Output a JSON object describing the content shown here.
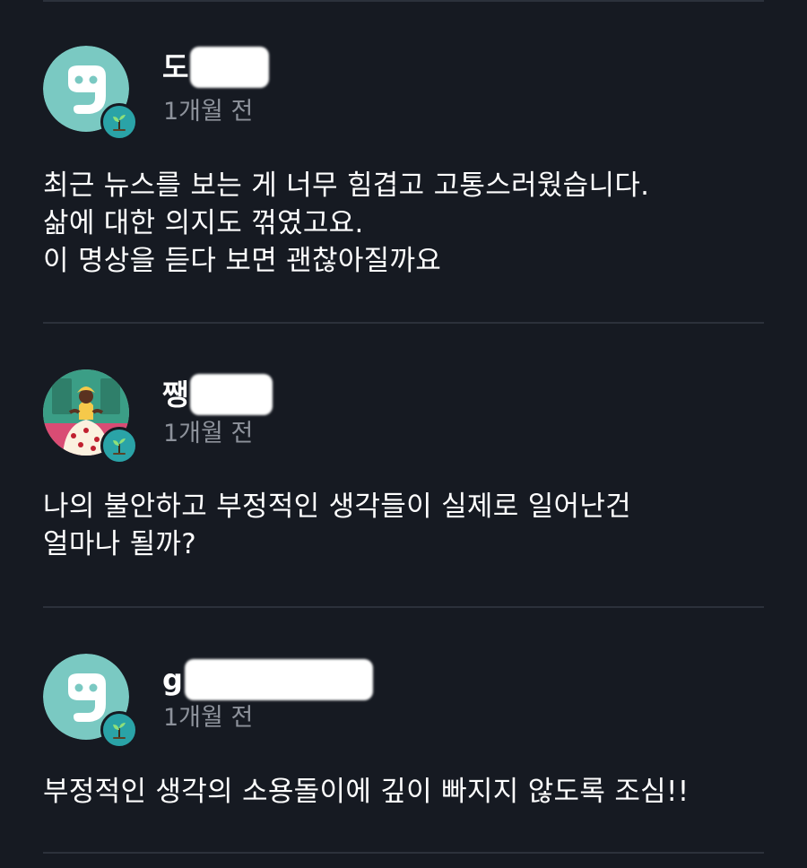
{
  "comments": [
    {
      "username_visible": "도",
      "time": "1개월 전",
      "avatar": "smiley-face-avatar",
      "text": "최근 뉴스를 보는 게 너무 힘겹고 고통스러웠습니다.\n삶에 대한 의지도 꺾였고요.\n이 명상을 듣다 보면 괜찮아질까요"
    },
    {
      "username_visible": "쨍",
      "time": "1개월 전",
      "avatar": "illustrated-woman-avatar",
      "text": "나의 불안하고 부정적인 생각들이 실제로 일어난건\n얼마나 될까?"
    },
    {
      "username_visible": "g",
      "time": "1개월 전",
      "avatar": "smiley-face-avatar",
      "text": "부정적인 생각의 소용돌이에 깊이 빠지지 않도록 조심!!"
    }
  ],
  "colors": {
    "background": "#161a22",
    "divider": "#2c313b",
    "avatar_teal": "#7ac9c2",
    "badge": "#2aa3a7",
    "time_text": "#8d929b"
  },
  "icons": {
    "badge": "sprout-icon"
  }
}
